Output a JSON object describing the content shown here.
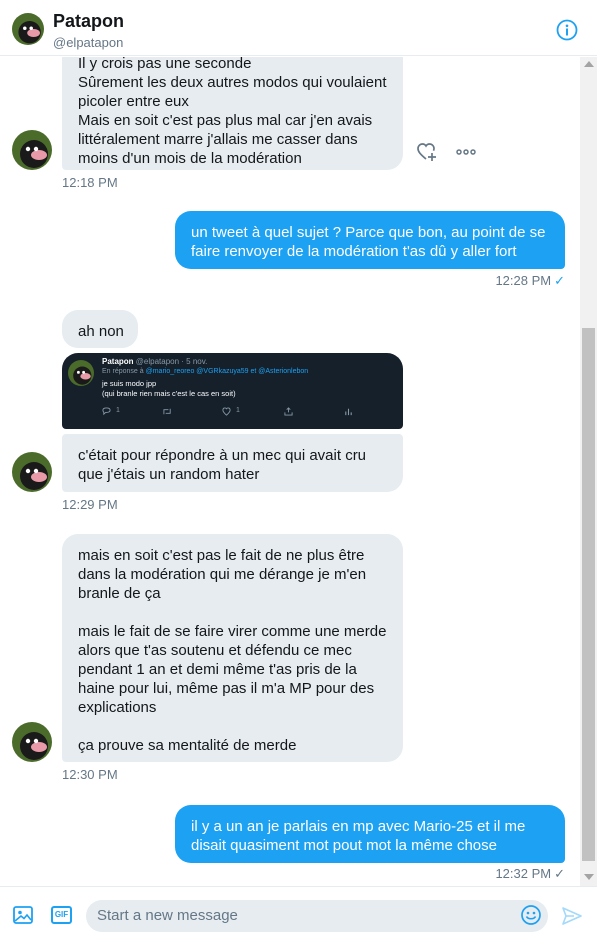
{
  "header": {
    "name": "Patapon",
    "handle": "@elpatapon"
  },
  "messages": [
    {
      "lines": [
        "Il y crois pas une seconde",
        "Sûrement les deux autres modos qui voulaient",
        "picoler entre eux",
        "Mais en soit c'est pas plus mal car j'en avais",
        "littéralement marre j'allais me casser dans",
        "moins d'un mois de la modération"
      ],
      "time": "12:18 PM"
    },
    {
      "lines": [
        "un tweet à quel sujet ? Parce que bon, au point de se",
        "faire renvoyer de la modération t'as dû y aller fort"
      ],
      "time": "12:28 PM",
      "check": "✓"
    },
    {
      "lines": [
        "ah non"
      ]
    },
    {
      "lines": [
        "c'était pour répondre à un mec qui avait cru",
        "que j'étais un random hater"
      ],
      "time": "12:29 PM"
    },
    {
      "lines": [
        "mais en soit c'est pas le fait de ne plus être",
        "dans la modération qui me dérange je m'en",
        "branle de ça",
        "",
        "mais le fait de se faire virer comme une merde",
        "alors que t'as soutenu et défendu ce mec",
        "pendant 1 an et demi même t'as pris de la",
        "haine pour lui, même pas il m'a MP pour des",
        "explications",
        "",
        "ça prouve sa mentalité de merde"
      ],
      "time": "12:30 PM"
    },
    {
      "lines": [
        "il y a un an je parlais en mp avec Mario-25 et il me",
        "disait quasiment mot pout mot la même chose"
      ],
      "time": "12:32 PM",
      "check": "✓"
    }
  ],
  "tweet": {
    "author": "Patapon",
    "meta": "@elpatapon · 5 nov.",
    "reply_prefix": "En réponse à",
    "mentions": "@mario_reoreo @VGRkazuya59  et  @Asterionlebon",
    "body_line1": "je suis modo jpp",
    "body_line2": "(qui branle rien mais c'est le cas en soit)",
    "replies": "1",
    "likes": "1"
  },
  "composer": {
    "placeholder": "Start a new message",
    "gif_label": "GIF"
  },
  "colors": {
    "accent": "#1da1f2",
    "received_bubble": "#e6ecf0",
    "tweet_bg": "#15202b"
  }
}
